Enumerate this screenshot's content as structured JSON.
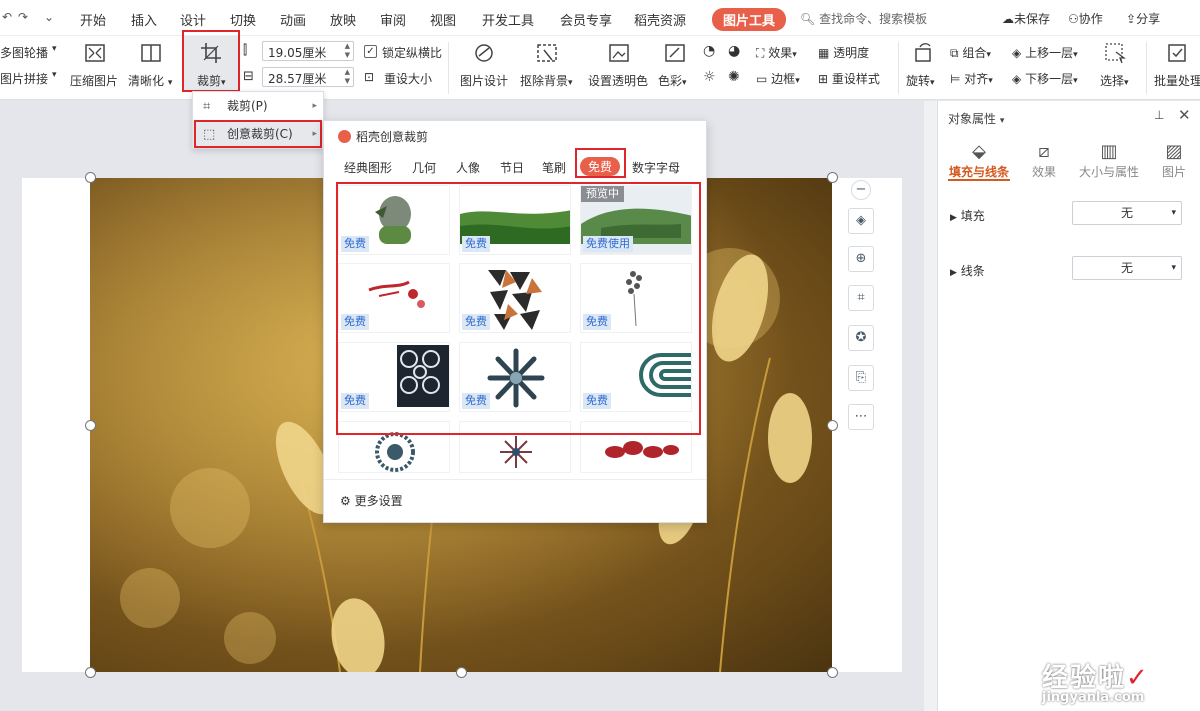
{
  "quick_access": {
    "undo": "↶",
    "redo": "↷",
    "more": "⌄"
  },
  "menu_tabs": [
    "开始",
    "插入",
    "设计",
    "切换",
    "动画",
    "放映",
    "审阅",
    "视图",
    "开发工具",
    "会员专享",
    "稻壳资源"
  ],
  "active_tab": "图片工具",
  "search_text": "查找命令、搜索模板",
  "right_links": {
    "unsaved": "未保存",
    "collab": "协作",
    "share": "分享"
  },
  "ribbon": {
    "outline": "多图轮播",
    "puzzle": "图片拼接",
    "compress": "压缩图片",
    "sharpen": "清晰化",
    "crop": "裁剪",
    "height": "19.05厘米",
    "width": "28.57厘米",
    "lock_ratio": "锁定纵横比",
    "reset_size": "重设大小",
    "design": "图片设计",
    "remove_bg": "抠除背景",
    "set_transparent": "设置透明色",
    "color": "色彩",
    "effect": "效果",
    "transparency": "透明度",
    "border": "边框",
    "reset_style": "重设样式",
    "rotate": "旋转",
    "group": "组合",
    "align": "对齐",
    "bring_forward": "上移一层",
    "send_backward": "下移一层",
    "select": "选择",
    "batch": "批量处理"
  },
  "context_menu": [
    {
      "label": "裁剪(P)"
    },
    {
      "label": "创意裁剪(C)"
    }
  ],
  "popup": {
    "title": "稻壳创意裁剪",
    "categories": [
      "经典图形",
      "几何",
      "人像",
      "节日",
      "笔刷",
      "免费",
      "数字字母"
    ],
    "active_category": "免费",
    "free_label": "免费",
    "free_use_label": "免费使用",
    "preview_label": "预览中",
    "more_settings": "更多设置"
  },
  "panel": {
    "title": "对象属性",
    "tabs": [
      "填充与线条",
      "效果",
      "大小与属性",
      "图片"
    ],
    "fill_label": "填充",
    "fill_value": "无",
    "line_label": "线条",
    "line_value": "无"
  },
  "watermark": {
    "cn": "经验啦",
    "check": "✓",
    "url": "jingyanla.com"
  },
  "colors": {
    "accent": "#e8604a",
    "highlight": "#e0252b",
    "free_badge": "#2f6bd0"
  }
}
